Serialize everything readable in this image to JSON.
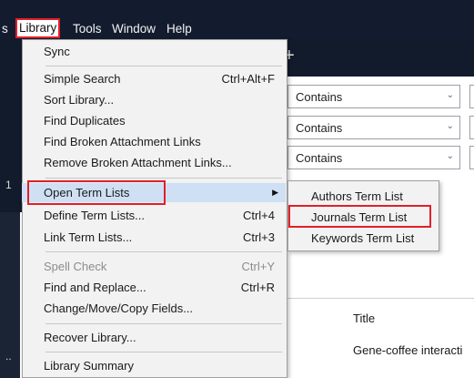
{
  "menubar": {
    "partial_left": "s",
    "items": [
      "Library",
      "Tools",
      "Window",
      "Help"
    ]
  },
  "background": {
    "plus": "+",
    "side_label": "1",
    "dots": "..",
    "search_rows": [
      {
        "operator": "Contains"
      },
      {
        "operator": "Contains"
      },
      {
        "operator": "Contains"
      }
    ],
    "column_header": "Title",
    "row_text": "Gene-coffee interacti"
  },
  "library_menu": {
    "items": [
      {
        "label": "Sync",
        "shortcut": ""
      },
      {
        "label": "Simple Search",
        "shortcut": "Ctrl+Alt+F"
      },
      {
        "label": "Sort Library...",
        "shortcut": ""
      },
      {
        "label": "Find Duplicates",
        "shortcut": ""
      },
      {
        "label": "Find Broken Attachment Links",
        "shortcut": ""
      },
      {
        "label": "Remove Broken Attachment Links...",
        "shortcut": ""
      },
      {
        "label": "Open Term Lists",
        "shortcut": ""
      },
      {
        "label": "Define Term Lists...",
        "shortcut": "Ctrl+4"
      },
      {
        "label": "Link Term Lists...",
        "shortcut": "Ctrl+3"
      },
      {
        "label": "Spell Check",
        "shortcut": "Ctrl+Y"
      },
      {
        "label": "Find and Replace...",
        "shortcut": "Ctrl+R"
      },
      {
        "label": "Change/Move/Copy Fields...",
        "shortcut": ""
      },
      {
        "label": "Recover Library...",
        "shortcut": ""
      },
      {
        "label": "Library Summary",
        "shortcut": ""
      }
    ]
  },
  "term_lists_submenu": {
    "items": [
      "Authors Term List",
      "Journals Term List",
      "Keywords Term List"
    ]
  },
  "colors": {
    "menubar_bg": "#131c2e",
    "menu_bg": "#f2f2f2",
    "highlight": "#cfe0f4",
    "annotation_red": "#e0202a"
  }
}
